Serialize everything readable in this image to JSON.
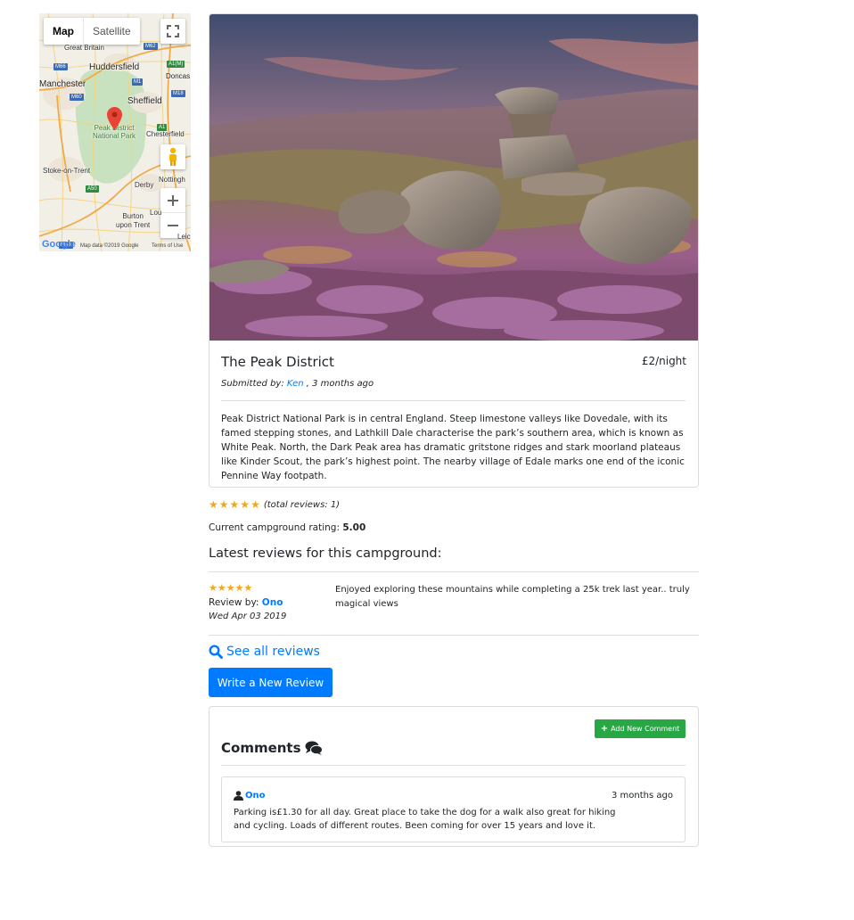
{
  "map": {
    "type_controls": [
      "Map",
      "Satellite"
    ],
    "active_type": "Map",
    "labels": {
      "great_britain": "Great Britain",
      "huddersfield": "Huddersfield",
      "doncaster": "Doncas",
      "manchester": "Manchester",
      "sheffield": "Sheffield",
      "park": "Peak District\nNational Park",
      "chesterfield": "Chesterfield",
      "stoke": "Stoke-on-Trent",
      "derby": "Derby",
      "nottingham": "Nottingh",
      "burton": "Burton\nupon Trent",
      "lough": "Lou",
      "leicester": "Leices"
    },
    "shields": [
      "M62",
      "A1(M)",
      "M66",
      "M1",
      "M60",
      "M18",
      "A50",
      "M54",
      "A1"
    ],
    "google_logo": "Google",
    "map_data": "Map data ©2019 Google",
    "terms": "Terms of Use",
    "icons": [
      "fullscreen-icon",
      "pegman-icon",
      "zoom-in-icon",
      "zoom-out-icon",
      "map-marker-icon"
    ]
  },
  "campground": {
    "name": "The Peak District",
    "price": "£2/night",
    "submitted_prefix": "Submitted by: ",
    "author": "Ken",
    "submitted_suffix": " , 3 months ago",
    "description": "Peak District National Park is in central England. Steep limestone valleys like Dovedale, with its famed stepping stones, and Lathkill Dale characterise the park’s southern area, which is known as White Peak. North, the Dark Peak area has dramatic gritstone ridges and stark moorland plateaus like Kinder Scout, the park’s highest point. The nearby village of Edale marks one end of the iconic Pennine Way footpath."
  },
  "rating": {
    "stars": 5,
    "total_reviews_text": "(total reviews: 1)",
    "current_label": "Current campground rating: ",
    "current_value": "5.00",
    "star_color": "#f2a71b"
  },
  "reviews": {
    "heading": "Latest reviews for this campground:",
    "items": [
      {
        "stars": 5,
        "by_label": "Review by: ",
        "author": "Ono",
        "date": "Wed Apr 03 2019",
        "text": "Enjoyed exploring these mountains while completing a 25k trek last year.. truly magical views"
      }
    ],
    "see_all": "See all reviews",
    "write_button": "Write a New Review"
  },
  "comments": {
    "title": "Comments",
    "add_button": "Add New Comment",
    "items": [
      {
        "author": "Ono",
        "time": "3 months ago",
        "text": "Parking is£1.30 for all day. Great place to take the dog for a walk also great for hiking and cycling. Loads of different routes. Been coming for over 15 years and love it."
      }
    ]
  },
  "colors": {
    "link": "#007bff",
    "primary_button": "#007bff",
    "success_button": "#28a745",
    "star": "#f2a71b"
  }
}
